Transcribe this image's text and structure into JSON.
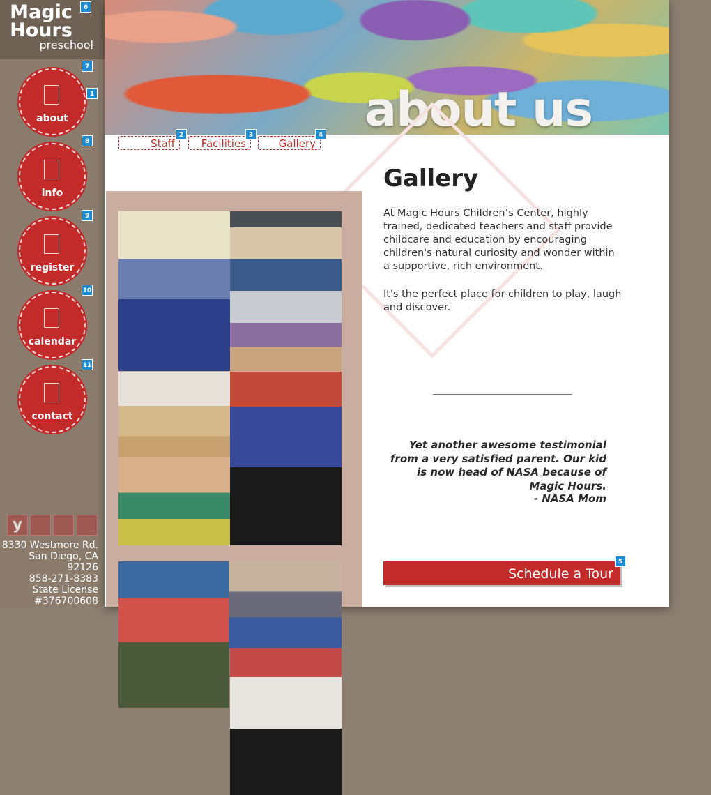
{
  "logo": {
    "line1": "Magic",
    "line2": "Hours",
    "line3": "preschool"
  },
  "hero": {
    "title": "about us"
  },
  "tabs": [
    {
      "label": "Staff",
      "badge": "2"
    },
    {
      "label": "Facilities",
      "badge": "3"
    },
    {
      "label": "Gallery",
      "badge": "4"
    }
  ],
  "nav": [
    {
      "label": "about",
      "badge": "7"
    },
    {
      "label": "info",
      "badge": "8"
    },
    {
      "label": "register",
      "badge": "9"
    },
    {
      "label": "calendar",
      "badge": "10"
    },
    {
      "label": "contact",
      "badge": "11"
    }
  ],
  "badges": {
    "logo": "6",
    "about_extra": "1",
    "tour": "5"
  },
  "social": [
    {
      "icon": "yelp-icon",
      "glyph": "y"
    },
    {
      "icon": "facebook-icon",
      "glyph": ""
    },
    {
      "icon": "google-icon",
      "glyph": ""
    },
    {
      "icon": "map-icon",
      "glyph": ""
    }
  ],
  "address": {
    "street": "8330 Westmore Rd.",
    "city": "San Diego, CA 92126",
    "phone": "858-271-8383",
    "license_label": "State License",
    "license_number": "#376700608"
  },
  "content": {
    "heading": "Gallery",
    "paragraph1": "At Magic Hours Children’s Center, highly trained, dedicated teachers and staff provide childcare and education by encouraging children's natural curiosity and wonder within a supportive, rich environment.",
    "paragraph2": "It's the perfect place for children to play, laugh and discover.",
    "testimonial": "Yet another awesome testimonial  from a very satisfied parent. Our kid is now head of NASA because of Magic Hours.",
    "testimonial_author": "- NASA Mom",
    "cta": "Schedule a Tour"
  },
  "colors": {
    "brand_red": "#c32a2a",
    "sidebar": "#8a7b6c",
    "badge_blue": "#1f8bd1",
    "gallery_bg": "#c9ada1"
  }
}
